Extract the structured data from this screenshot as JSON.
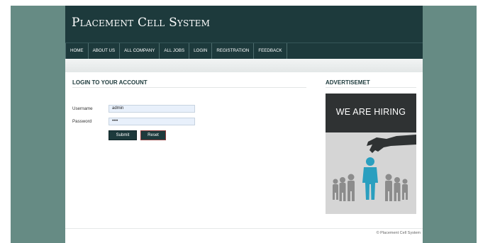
{
  "header": {
    "title": "Placement Cell System"
  },
  "nav": {
    "items": [
      "HOME",
      "ABOUT US",
      "ALL COMPANY",
      "ALL JOBS",
      "LOGIN",
      "REGISTRATION",
      "FEEDBACK"
    ]
  },
  "login": {
    "title": "LOGIN TO YOUR ACCOUNT",
    "username_label": "Username",
    "username_value": "admin",
    "password_label": "Password",
    "password_value": "••••",
    "submit_label": "Submit",
    "reset_label": "Reset"
  },
  "advert": {
    "title": "ADVERTISEMET",
    "banner_text": "WE ARE HIRING",
    "banner_bg": "#2f3233",
    "highlight_color": "#2a9fbf"
  },
  "footer": {
    "text": "© Placement Cell System"
  },
  "colors": {
    "accent": "#1d3a3c",
    "background": "#668b84"
  }
}
